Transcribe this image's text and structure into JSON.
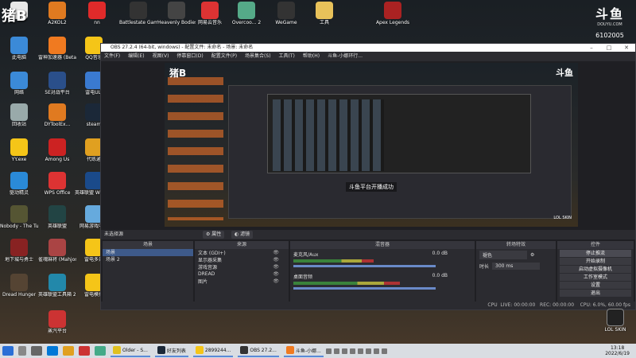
{
  "overlay": {
    "watermark": "猪B",
    "douyu_logo": "斗鱼",
    "douyu_url": "DOUYU.COM",
    "room_id": "6102005"
  },
  "desktop_icons": [
    {
      "label": "",
      "color": "#e8e8e8"
    },
    {
      "label": "A2KOL2",
      "color": "#e07a20"
    },
    {
      "label": "nn",
      "color": "#e02a2a"
    },
    {
      "label": "Battlestate Games L...",
      "color": "#333"
    },
    {
      "label": "Heavenly Bodies",
      "color": "#444"
    },
    {
      "label": "网易云音乐",
      "color": "#d33"
    },
    {
      "label": "Overcoo... 2",
      "color": "#5a8"
    },
    {
      "label": "WeGame",
      "color": "#333"
    },
    {
      "label": "工具",
      "color": "#e8c25a"
    },
    {
      "label": "Apex Legends",
      "color": "#a22"
    },
    {
      "label": "此电脑",
      "color": "#3b8ad8"
    },
    {
      "label": "雷神加速器 (Beta版)",
      "color": "#f07a20"
    },
    {
      "label": "QQ音乐",
      "color": "#f5c518"
    },
    {
      "label": "网络",
      "color": "#3b8ad8"
    },
    {
      "label": "5E对战平台",
      "color": "#2a4f8a"
    },
    {
      "label": "雷电ULI",
      "color": "#3a7ad0"
    },
    {
      "label": "回收站",
      "color": "#9aa"
    },
    {
      "label": "DYToolEx...",
      "color": "#e07a20"
    },
    {
      "label": "steam",
      "color": "#1b2838"
    },
    {
      "label": "YY.exe",
      "color": "#f5c518"
    },
    {
      "label": "Among Us",
      "color": "#c22"
    },
    {
      "label": "代练通",
      "color": "#e0a020"
    },
    {
      "label": "驱动精灵",
      "color": "#2a8ad8"
    },
    {
      "label": "WPS Office",
      "color": "#d33"
    },
    {
      "label": "英雄联盟 WeGam",
      "color": "#1a4a8a"
    },
    {
      "label": "Nobody - The Turna...",
      "color": "#553"
    },
    {
      "label": "英雄联盟",
      "color": "#244"
    },
    {
      "label": "网易游戏中心",
      "color": "#6ad"
    },
    {
      "label": "地下城与勇士",
      "color": "#822"
    },
    {
      "label": "雀魂麻将 (Mahjong...",
      "color": "#a44"
    },
    {
      "label": "雷电多开",
      "color": "#f5c518"
    },
    {
      "label": "Dread Hunger",
      "color": "#543"
    },
    {
      "label": "英雄联盟工具箱 2022",
      "color": "#28a"
    },
    {
      "label": "雷电模拟",
      "color": "#f5c518"
    },
    {
      "label": "蒸汽平台",
      "color": "#c33"
    }
  ],
  "obs": {
    "title": "OBS 27.2.4 (64-bit, windows) - 配置文件: 未命名 - 场景: 未命名",
    "menu": [
      "文件(F)",
      "编辑(E)",
      "视图(V)",
      "停靠窗口(D)",
      "配置文件(P)",
      "场景集合(S)",
      "工具(T)",
      "帮助(H)",
      "斗鱼-小娜环行..."
    ],
    "preview_toast": "斗鱼平台开播成功",
    "preview_watermark": "猪B",
    "preview_douyu": "斗鱼",
    "preview_lol": "LOL SKIN",
    "toolbar": {
      "no_source": "未选择源",
      "properties": "属性",
      "filters": "滤镜"
    },
    "docks": {
      "scenes": {
        "title": "场景",
        "items": [
          "场景",
          "场景 2"
        ],
        "footer": "+ − ∧ ∨"
      },
      "sources": {
        "title": "来源",
        "items": [
          "文本 (GDI+)",
          "显示器采集",
          "游戏音源",
          "DREAD",
          "图片"
        ],
        "footer": "+ − ⚙ ∧ ∨"
      },
      "mixer": {
        "title": "混音器",
        "channels": [
          {
            "name": "麦克风/Aux",
            "db": "0.0 dB",
            "level": 0.45
          },
          {
            "name": "桌面音频",
            "db": "0.0 dB",
            "level": 0.6
          }
        ]
      },
      "transitions": {
        "title": "转场特效",
        "type": "褪色",
        "duration_label": "时长",
        "duration": "300 ms"
      },
      "controls": {
        "title": "控件",
        "buttons": [
          "停止推流",
          "开始录制",
          "启动虚拟摄像机",
          "工作室模式",
          "设置",
          "退出"
        ]
      }
    },
    "status": "CPU  LIVE: 00:00:00   REC: 00:00:00    CPU: 6.0%, 60.00 fps"
  },
  "lol_skin": "LOL SKIN",
  "taskbar": {
    "apps": [
      {
        "label": "Older - S...",
        "color": "#e0c020"
      },
      {
        "label": "好友列表",
        "color": "#1b2838"
      },
      {
        "label": "2899244...",
        "color": "#f5c518"
      },
      {
        "label": "OBS 27.2...",
        "color": "#333"
      },
      {
        "label": "斗鱼-小娜...",
        "color": "#f07a20"
      }
    ],
    "time": "13:18",
    "date": "2022/6/19"
  }
}
